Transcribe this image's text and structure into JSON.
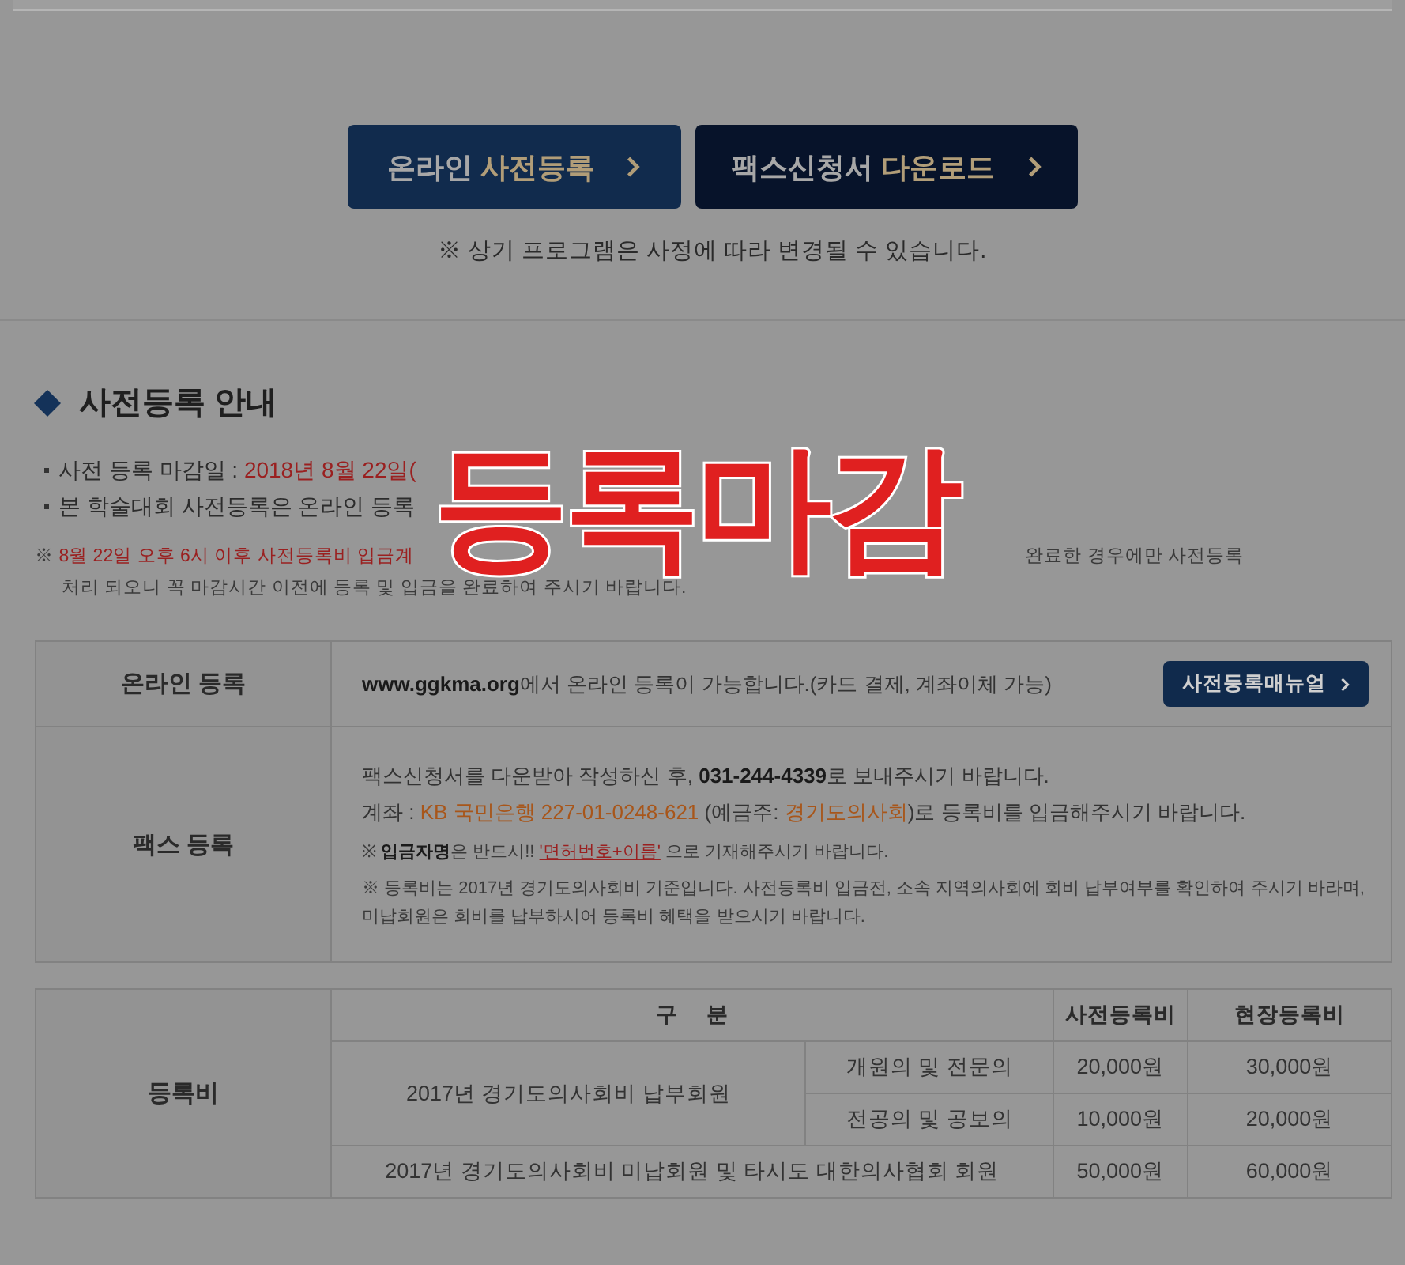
{
  "top_buttons": [
    {
      "kind": "navy",
      "label": "온라인 ",
      "highlight": "사전등록"
    },
    {
      "kind": "dark",
      "label": "팩스신청서 ",
      "highlight": "다운로드"
    }
  ],
  "notice": "※ 상기 프로그램은 사정에 따라 변경될 수 있습니다.",
  "section": {
    "title": "사전등록 안내",
    "bullets": [
      {
        "segments": [
          {
            "kind": "plain",
            "text": "사전 등록 마감일 : "
          },
          {
            "kind": "alert",
            "text": "2018년 8월 22일("
          }
        ]
      },
      {
        "segments": [
          {
            "kind": "plain",
            "text": "본 학술대회 사전등록은 온라인 등록"
          }
        ]
      }
    ],
    "note": [
      {
        "segments": [
          {
            "kind": "plain",
            "text": "※ "
          },
          {
            "kind": "alert",
            "text": "8월 22일 오후 6시 이후 사전등록비 입금계"
          }
        ],
        "tail": [
          {
            "kind": "plain",
            "text": "완료한 경우에만 사전등록"
          }
        ]
      },
      {
        "segments": [
          {
            "kind": "plain",
            "text": "처리 되오니 꼭 마감시간 이전에 등록 및 입금을 완료하여 주시기 바랍니다."
          }
        ]
      }
    ]
  },
  "stamp": "등록마감",
  "methods": [
    {
      "label": "온라인 등록",
      "lines": [
        [
          {
            "kind": "strong",
            "text": "www.ggkma.org"
          },
          {
            "kind": "plain",
            "text": "에서 온라인 등록이 가능합니다.(카드 결제, 계좌이체 가능)"
          }
        ]
      ],
      "button": "사전등록매뉴얼"
    },
    {
      "label": "팩스 등록",
      "lines": [
        [
          {
            "kind": "plain",
            "text": "팩스신청서를 다운받아 작성하신 후, "
          },
          {
            "kind": "strong",
            "text": "031-244-4339"
          },
          {
            "kind": "plain",
            "text": "로 보내주시기 바랍니다."
          }
        ],
        [
          {
            "kind": "plain",
            "text": "계좌 : "
          },
          {
            "kind": "accent",
            "text": "KB 국민은행 227-01-0248-621"
          },
          {
            "kind": "plain",
            "text": " (예금주: "
          },
          {
            "kind": "accent",
            "text": "경기도의사회"
          },
          {
            "kind": "plain",
            "text": ")로 등록비를 입금해주시기 바랍니다."
          }
        ]
      ],
      "notes": [
        [
          {
            "kind": "plain",
            "text": "※ "
          },
          {
            "kind": "strong",
            "text": "입금자명"
          },
          {
            "kind": "plain",
            "text": "은 반드시!! "
          },
          {
            "kind": "alert-underline",
            "text": "'면허번호+이름'"
          },
          {
            "kind": "plain",
            "text": " 으로 기재해주시기 바랍니다."
          }
        ],
        [
          {
            "kind": "plain",
            "text": "※ 등록비는 2017년 경기도의사회비 기준입니다. 사전등록비 입금전, 소속 지역의사회에 회비 납부여부를 확인하여 주시기 바라며, 미납회원은 회비를 납부하시어 등록비 혜택을 받으시기 바랍니다."
          }
        ]
      ]
    }
  ],
  "fees": {
    "label": "등록비",
    "header": [
      "구 분",
      "사전등록비",
      "현장등록비"
    ],
    "groups": [
      {
        "name": "2017년 경기도의사회비 납부회원",
        "rows": [
          {
            "type": "개원의 및 전문의",
            "pre": "20,000원",
            "onsite": "30,000원"
          },
          {
            "type": "전공의 및 공보의",
            "pre": "10,000원",
            "onsite": "20,000원"
          }
        ]
      },
      {
        "name": "2017년 경기도의사회비 미납회원 및 타시도 대한의사협회 회원",
        "rows": [
          {
            "pre": "50,000원",
            "onsite": "60,000원"
          }
        ]
      }
    ]
  }
}
